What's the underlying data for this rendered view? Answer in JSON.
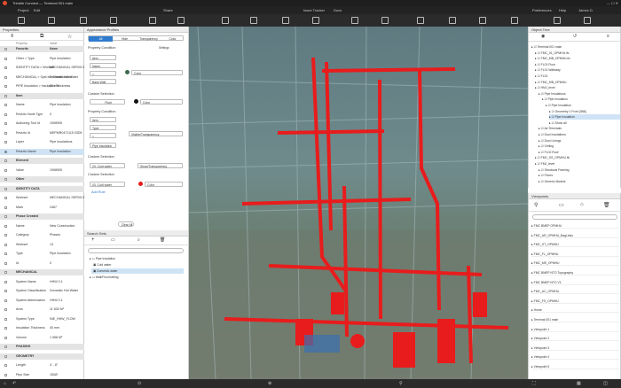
{
  "app": {
    "title": "Trimble Connect — Terminal 001 main"
  },
  "menu": {
    "project": "Project",
    "edit": "Edit",
    "share": "Share",
    "issue_tracker": "Issue Tracker",
    "docs": "Docs",
    "preferences": "Preferences",
    "help": "Help",
    "user": "James D."
  },
  "properties": {
    "title": "Properties",
    "col_property": "Property",
    "col_value": "Value",
    "rows": [
      {
        "type": "cat",
        "label": "Favorite",
        "value": "None"
      },
      {
        "type": "row",
        "label": "Other > Type",
        "value": "Pipe Insulation"
      },
      {
        "type": "row",
        "label": "IDENTITY DATA > Workset",
        "value": "MECHANICAL SERVICE SOCTMORE"
      },
      {
        "type": "row",
        "label": "MECHANICAL > Syst em Classification",
        "value": "Domestic Hot Water"
      },
      {
        "type": "row",
        "label": "PIPE Insulation > Insulation Thickness",
        "value": "40 mm"
      },
      {
        "type": "cat",
        "label": "Item",
        "value": ""
      },
      {
        "type": "row",
        "label": "Name",
        "value": "Pipe Insulation"
      },
      {
        "type": "row",
        "label": "Revizto Node Type",
        "value": "0"
      },
      {
        "type": "row",
        "label": "Authoring Tool Id",
        "value": "1908905"
      },
      {
        "type": "row",
        "label": "Revizto Id",
        "value": "MEPMR0471115 03D5"
      },
      {
        "type": "row",
        "label": "Layer",
        "value": "Pipe Insulations"
      },
      {
        "type": "row",
        "label": "Revizto Name",
        "value": "Pipe Insulation",
        "sel": true
      },
      {
        "type": "cat",
        "label": "Element",
        "value": ""
      },
      {
        "type": "row",
        "label": "Value",
        "value": "1908905"
      },
      {
        "type": "cat",
        "label": "Other",
        "value": ""
      },
      {
        "type": "cat",
        "label": "IDENTITY DATA",
        "value": ""
      },
      {
        "type": "row",
        "label": "Workset",
        "value": "MECHANICAL SERVICE SOCTMORE"
      },
      {
        "type": "row",
        "label": "Mark",
        "value": "2467"
      },
      {
        "type": "cat",
        "label": "Phase Created",
        "value": ""
      },
      {
        "type": "row",
        "label": "Name",
        "value": "New Construction"
      },
      {
        "type": "row",
        "label": "Category",
        "value": "Phases"
      },
      {
        "type": "row",
        "label": "Workset",
        "value": "13"
      },
      {
        "type": "row",
        "label": "Type",
        "value": "Pipe Insulation"
      },
      {
        "type": "row",
        "label": "Id",
        "value": "0"
      },
      {
        "type": "cat",
        "label": "MECHANICAL",
        "value": ""
      },
      {
        "type": "row",
        "label": "System Name",
        "value": "HHW 0.1"
      },
      {
        "type": "row",
        "label": "System Classification",
        "value": "Domestic Hot Water"
      },
      {
        "type": "row",
        "label": "System Abbreviation",
        "value": "HHW 0.1"
      },
      {
        "type": "row",
        "label": "Area",
        "value": "11 830 M²"
      },
      {
        "type": "row",
        "label": "System Type",
        "value": "INE_HHW_FLOW"
      },
      {
        "type": "row",
        "label": "Insulation Thickness",
        "value": "40 mm"
      },
      {
        "type": "row",
        "label": "Volume",
        "value": "1 558 M³"
      },
      {
        "type": "cat",
        "label": "PHASING",
        "value": ""
      },
      {
        "type": "cat",
        "label": "GEOMETRY",
        "value": ""
      },
      {
        "type": "row",
        "label": "Length",
        "value": "4' - 8\""
      },
      {
        "type": "row",
        "label": "Pipe Size",
        "value": "150Ø"
      }
    ]
  },
  "appearance": {
    "title": "Appearance Profiles",
    "tabs": [
      "All",
      "Hide",
      "Transparency",
      "Color"
    ],
    "settings": "Settings",
    "property_condition": "Property Condition",
    "custom_selection": "Custom Selection",
    "dd_item": "Item",
    "dd_name": "Name",
    "dd_eq": "=",
    "dd_base_wall": "Base Wall",
    "color_label": "Color",
    "fluid_label": "Fluid",
    "dd_type": "Type",
    "dd_pipe_insulation": "Pipe Insulation",
    "visible_transparency": "Visible/Transparency",
    "cold_water": "03. Cold water",
    "show_transparency": "Show/Transparency",
    "add_rule": "Add Rule",
    "clear_all": "Clear All"
  },
  "search_sets": {
    "title": "Search Sets",
    "search_placeholder": "Search",
    "items": [
      "Pipe Insulation",
      "Cold water",
      "Domestic water",
      "Wall/Floor/ceiling"
    ]
  },
  "object_tree": {
    "title": "Object Tree",
    "items": [
      {
        "d": 0,
        "t": "Terminal 001 main"
      },
      {
        "d": 1,
        "t": "FMC_01_OPMHU.ifc"
      },
      {
        "d": 1,
        "t": "FMC_MB_OPMHU.ifc"
      },
      {
        "d": 1,
        "t": "FL01 Floor"
      },
      {
        "d": 1,
        "t": "FL01 Walkway"
      },
      {
        "d": 1,
        "t": "FL02"
      },
      {
        "d": 1,
        "t": "FMC_MB_OPMHU"
      },
      {
        "d": 1,
        "t": "HMJ_level"
      },
      {
        "d": 2,
        "t": "Pipe Insulations"
      },
      {
        "d": 3,
        "t": "Pipe Insulation"
      },
      {
        "d": 4,
        "t": "Pipe Insulation"
      },
      {
        "d": 5,
        "t": "Geometry 1 Front [586]"
      },
      {
        "d": 5,
        "t": "Pipe Insulation",
        "sel": true
      },
      {
        "d": 5,
        "t": "Show all"
      },
      {
        "d": 2,
        "t": "Air Terminals"
      },
      {
        "d": 2,
        "t": "Duct Insulations"
      },
      {
        "d": 2,
        "t": "Duct Linings"
      },
      {
        "d": 2,
        "t": "Ceiling"
      },
      {
        "d": 2,
        "t": "FL02 Roof"
      },
      {
        "d": 1,
        "t": "FMC_SS_OPMHU.ifc"
      },
      {
        "d": 1,
        "t": "FMJ_level"
      },
      {
        "d": 2,
        "t": "Structural Framing"
      },
      {
        "d": 2,
        "t": "Floors"
      },
      {
        "d": 2,
        "t": "Generic Models"
      }
    ]
  },
  "viewpoints": {
    "title": "Viewpoints",
    "items": [
      "FMC BMEP OPMHU",
      "FMC_AR_OPMHU_BagLinks",
      "FMC_ST_OPMHU",
      "FMC_FL_OPMHU",
      "FMC_ME_OPMHU",
      "FMC BMEP NTO Topography",
      "FMC BMEP NTO V1",
      "FMC_AC_OPMHU",
      "FMC_FS_OPMHU",
      "Home",
      "Terminal 001 main",
      "Viewpoint 1",
      "Viewpoint 2",
      "Viewpoint 3",
      "Viewpoint 4",
      "Viewpoint 5"
    ]
  },
  "colors": {
    "accent": "#2e7bcf",
    "pipe_red": "#e81c1c",
    "viewport_bg": "#6f8b8c"
  }
}
